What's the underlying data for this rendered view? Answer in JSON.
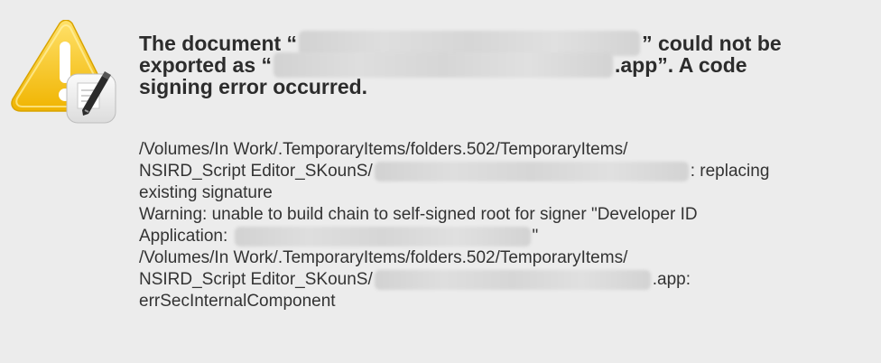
{
  "alert": {
    "icon": "script-editor-warning-icon",
    "heading": {
      "line1_before": "The document “",
      "line1_after": "” could not be",
      "line2_before": "exported as “",
      "line2_after": ".app”. A code",
      "line3": "signing error occurred."
    },
    "details": {
      "line1": "/Volumes/In Work/.TemporaryItems/folders.502/TemporaryItems/",
      "line2_before": "NSIRD_Script Editor_SKounS/",
      "line2_after": ": replacing",
      "line3": "existing signature",
      "line4": "Warning: unable to build chain to self-signed root for signer \"Developer ID",
      "line5_before": "Application: ",
      "line5_after": "\"",
      "line6": "/Volumes/In Work/.TemporaryItems/folders.502/TemporaryItems/",
      "line7_before": "NSIRD_Script Editor_SKounS/",
      "line7_after": ".app:",
      "line8": "errSecInternalComponent"
    }
  },
  "colors": {
    "background": "#ececec",
    "warning_yellow": "#f5c518",
    "text_primary": "#2c2c2c",
    "redaction": "#d8d8d8"
  }
}
